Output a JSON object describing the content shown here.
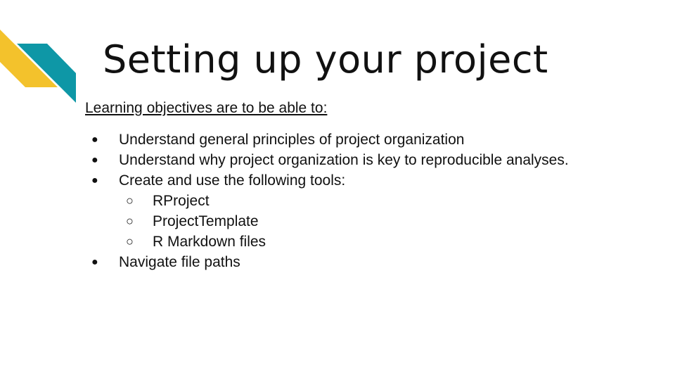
{
  "slide": {
    "title": "Setting up your project",
    "subtitle": "Learning objectives are to be able to:",
    "bullet_symbol": "●",
    "sub_bullet_symbol": "○",
    "items": [
      {
        "text": "Understand general principles of project organization"
      },
      {
        "text": "Understand why project organization is key to reproducible analyses."
      },
      {
        "text": "Create and use the following tools:",
        "subitems": [
          "RProject",
          "ProjectTemplate",
          "R Markdown files"
        ]
      },
      {
        "text": "Navigate file paths"
      }
    ]
  },
  "colors": {
    "accent_yellow": "#F3C22C",
    "accent_teal": "#0E97A6",
    "text": "#111111",
    "background": "#FFFFFF"
  }
}
